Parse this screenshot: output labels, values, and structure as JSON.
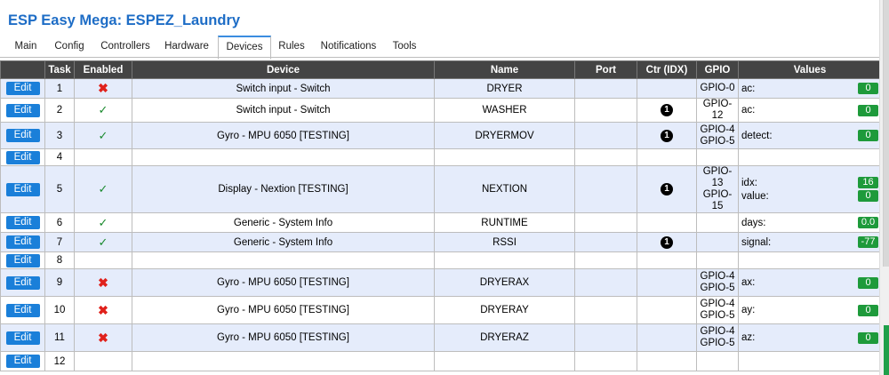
{
  "app": {
    "title": "ESP Easy Mega: ESPEZ_Laundry"
  },
  "tabs": [
    {
      "label": "Main"
    },
    {
      "label": "Config"
    },
    {
      "label": "Controllers"
    },
    {
      "label": "Hardware"
    },
    {
      "label": "Devices",
      "active": true
    },
    {
      "label": "Rules"
    },
    {
      "label": "Notifications"
    },
    {
      "label": "Tools"
    }
  ],
  "table": {
    "headers": [
      "",
      "Task",
      "Enabled",
      "Device",
      "Name",
      "Port",
      "Ctr (IDX)",
      "GPIO",
      "Values"
    ],
    "edit_label": "Edit",
    "rows": [
      {
        "task": "1",
        "enabled": "x",
        "device": "Switch input - Switch",
        "name": "DRYER",
        "port": "",
        "ctr": "",
        "gpio": [
          "GPIO-0"
        ],
        "values": [
          {
            "label": "ac:",
            "value": "0"
          }
        ]
      },
      {
        "task": "2",
        "enabled": "check",
        "device": "Switch input - Switch",
        "name": "WASHER",
        "port": "",
        "ctr": "1",
        "gpio": [
          "GPIO-12"
        ],
        "values": [
          {
            "label": "ac:",
            "value": "0"
          }
        ]
      },
      {
        "task": "3",
        "enabled": "check",
        "device": "Gyro - MPU 6050 [TESTING]",
        "name": "DRYERMOV",
        "port": "",
        "ctr": "1",
        "gpio": [
          "GPIO-4",
          "GPIO-5"
        ],
        "values": [
          {
            "label": "detect:",
            "value": "0"
          }
        ]
      },
      {
        "task": "4",
        "enabled": "",
        "device": "",
        "name": "",
        "port": "",
        "ctr": "",
        "gpio": [],
        "values": []
      },
      {
        "task": "5",
        "enabled": "check",
        "device": "Display - Nextion [TESTING]",
        "name": "NEXTION",
        "port": "",
        "ctr": "1",
        "gpio": [
          "GPIO-13",
          "GPIO-15"
        ],
        "values": [
          {
            "label": "idx:",
            "value": "16"
          },
          {
            "label": "value:",
            "value": "0"
          }
        ]
      },
      {
        "task": "6",
        "enabled": "check",
        "device": "Generic - System Info",
        "name": "RUNTIME",
        "port": "",
        "ctr": "",
        "gpio": [],
        "values": [
          {
            "label": "days:",
            "value": "0.0"
          }
        ]
      },
      {
        "task": "7",
        "enabled": "check",
        "device": "Generic - System Info",
        "name": "RSSI",
        "port": "",
        "ctr": "1",
        "gpio": [],
        "values": [
          {
            "label": "signal:",
            "value": "-77"
          }
        ]
      },
      {
        "task": "8",
        "enabled": "",
        "device": "",
        "name": "",
        "port": "",
        "ctr": "",
        "gpio": [],
        "values": []
      },
      {
        "task": "9",
        "enabled": "x",
        "device": "Gyro - MPU 6050 [TESTING]",
        "name": "DRYERAX",
        "port": "",
        "ctr": "",
        "gpio": [
          "GPIO-4",
          "GPIO-5"
        ],
        "values": [
          {
            "label": "ax:",
            "value": "0"
          }
        ]
      },
      {
        "task": "10",
        "enabled": "x",
        "device": "Gyro - MPU 6050 [TESTING]",
        "name": "DRYERAY",
        "port": "",
        "ctr": "",
        "gpio": [
          "GPIO-4",
          "GPIO-5"
        ],
        "values": [
          {
            "label": "ay:",
            "value": "0"
          }
        ]
      },
      {
        "task": "11",
        "enabled": "x",
        "device": "Gyro - MPU 6050 [TESTING]",
        "name": "DRYERAZ",
        "port": "",
        "ctr": "",
        "gpio": [
          "GPIO-4",
          "GPIO-5"
        ],
        "values": [
          {
            "label": "az:",
            "value": "0"
          }
        ]
      },
      {
        "task": "12",
        "enabled": "",
        "device": "",
        "name": "",
        "port": "",
        "ctr": "",
        "gpio": [],
        "values": []
      }
    ]
  },
  "icons": {
    "enabled_true": "checkmark-icon",
    "enabled_false": "x-mark-icon",
    "controller": "controller-index-icon"
  },
  "colors": {
    "title": "#1e6dc6",
    "header_bg": "#444444",
    "odd_row": "#e5ecfb",
    "edit_button": "#1a7fd9",
    "value_badge": "#1e9a3b",
    "disabled": "#e0211b",
    "enabled": "#1a8a2e"
  }
}
